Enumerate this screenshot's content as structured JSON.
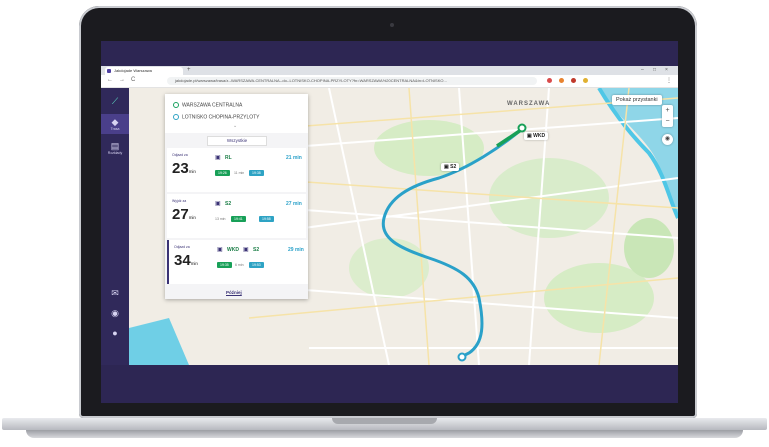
{
  "browser": {
    "tab_title": "Jakdojade Warszawa",
    "new_tab_glyph": "+",
    "url": "jakdojade.pl/warszawa/trasa/z--WARSZAWA-CENTRALNA--do--LOTNISKO-CHOPINA-PRZYLOTY?fn=WARSZAWA%20CENTRALNA&tn=LOTNISKO...",
    "nav": {
      "back": "←",
      "forward": "→",
      "reload": "C"
    },
    "window_controls": [
      "–",
      "□",
      "×"
    ]
  },
  "sidebar": {
    "items": [
      {
        "icon": "route-icon",
        "glyph": "⟋",
        "label": ""
      },
      {
        "icon": "directions-icon",
        "glyph": "◆",
        "label": "Trasa"
      },
      {
        "icon": "timetable-icon",
        "glyph": "▤",
        "label": "Rozkłady"
      },
      {
        "icon": "mail-icon",
        "glyph": "✉",
        "label": ""
      },
      {
        "icon": "android-icon",
        "glyph": "◉",
        "label": ""
      },
      {
        "icon": "apple-icon",
        "glyph": "●",
        "label": ""
      }
    ]
  },
  "route": {
    "from": "WARSZAWA CENTRALNA",
    "to": "LOTNISKO CHOPINA-PRZYLOTY"
  },
  "results": {
    "tab_label": "Wszystkie",
    "more_label": "Później",
    "items": [
      {
        "leave_label": "Odjazd za",
        "leave_value": "23",
        "leave_unit": "min",
        "lines": [
          "RL"
        ],
        "duration": "21 min",
        "times": [
          "19:26",
          "19:38"
        ],
        "walk": "11 min"
      },
      {
        "leave_label": "Wyjdź za",
        "leave_value": "27",
        "leave_unit": "min",
        "lines": [
          "S2"
        ],
        "duration": "27 min",
        "times": [
          "19:41",
          "19:58"
        ],
        "walk": "13 min"
      },
      {
        "leave_label": "Odjazd za",
        "leave_value": "34",
        "leave_unit": "min",
        "lines": [
          "WKD",
          "S2"
        ],
        "duration": "29 min",
        "times": [
          "19:35",
          "19:53"
        ],
        "walk": "6 min"
      }
    ]
  },
  "map": {
    "city_label": "WARSZAWA",
    "show_stops_label": "Pokaż przystanki",
    "zoom_in": "+",
    "zoom_out": "−",
    "compass": "◉",
    "stop_labels": [
      "S2",
      "WKD"
    ],
    "colors": {
      "route_blue": "#2aa1c9",
      "route_green": "#18a058",
      "water": "#4fc7e6",
      "park": "#c9e6b7"
    }
  }
}
